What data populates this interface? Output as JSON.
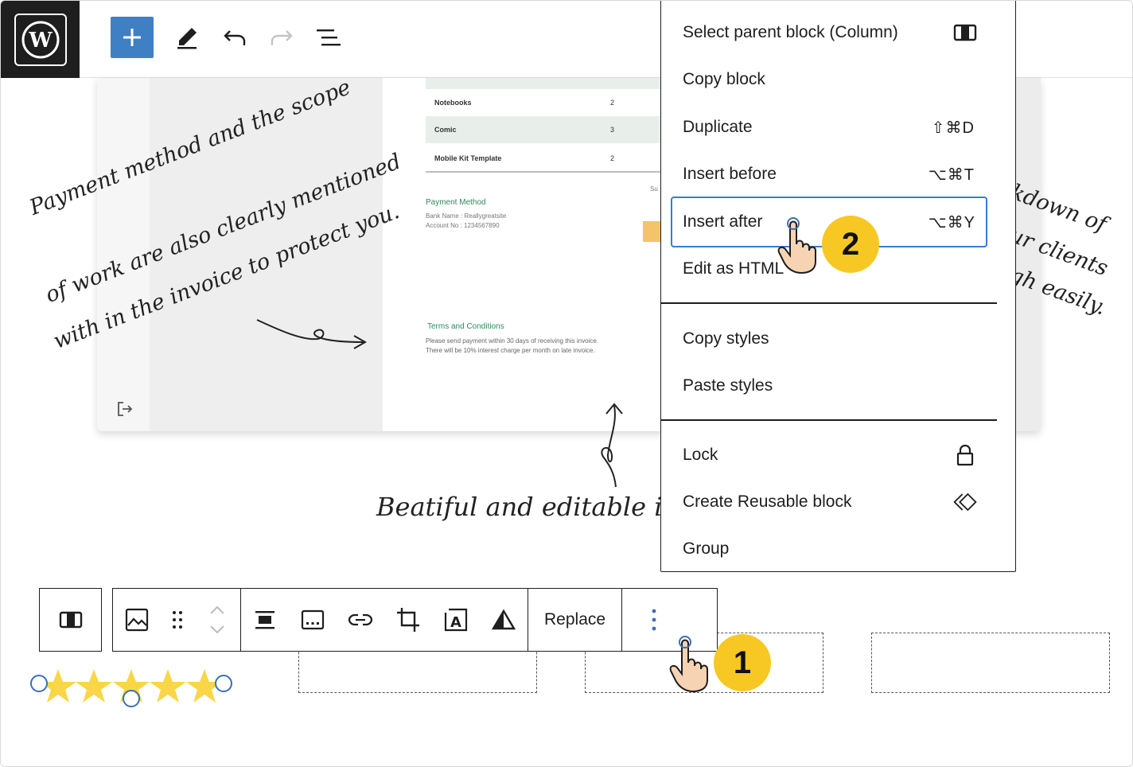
{
  "menu": {
    "items": [
      {
        "label": "Select parent block (Column)",
        "shortcut": "",
        "icon": "column-icon"
      },
      {
        "label": "Copy block",
        "shortcut": ""
      },
      {
        "label": "Duplicate",
        "shortcut": "⇧⌘D"
      },
      {
        "label": "Insert before",
        "shortcut": "⌥⌘T"
      },
      {
        "label": "Insert after",
        "shortcut": "⌥⌘Y"
      },
      {
        "label": "Edit as HTML",
        "shortcut": ""
      },
      {
        "label": "Copy styles",
        "shortcut": ""
      },
      {
        "label": "Paste styles",
        "shortcut": ""
      },
      {
        "label": "Lock",
        "shortcut": "",
        "icon": "lock-icon"
      },
      {
        "label": "Create Reusable block",
        "shortcut": "",
        "icon": "reusable-block-icon"
      },
      {
        "label": "Group",
        "shortcut": ""
      }
    ]
  },
  "block_toolbar": {
    "replace_label": "Replace"
  },
  "invoice": {
    "rows": [
      {
        "item": "Notebooks",
        "qty": "2"
      },
      {
        "item": "Comic",
        "qty": "3"
      },
      {
        "item": "Mobile Kit Template",
        "qty": "2"
      }
    ],
    "payment_title": "Payment Method",
    "payment_text": "Bank Name : Reallygreatsite\nAccount No : 1234567890",
    "terms_title": "Terms  and Conditions",
    "terms_text": "Please send payment within 30 days of receiving this invoice. There will be 10% interest charge per month on late invoice.",
    "sub_label": "Su"
  },
  "annotations": {
    "left_line1": "Payment method and the scope",
    "left_line2": "of work are also clearly mentioned",
    "left_line3": "with in the invoice to protect you.",
    "bottom": "Beatiful and editable invo",
    "right_line1": "kdown of",
    "right_line2": "ur clients",
    "right_line3": "gh easily."
  },
  "callouts": {
    "step1": "1",
    "step2": "2"
  },
  "colors": {
    "accent": "#3f7fc4",
    "focus": "#3a7bd5",
    "badge": "#f7c824",
    "star": "#f9d648"
  }
}
